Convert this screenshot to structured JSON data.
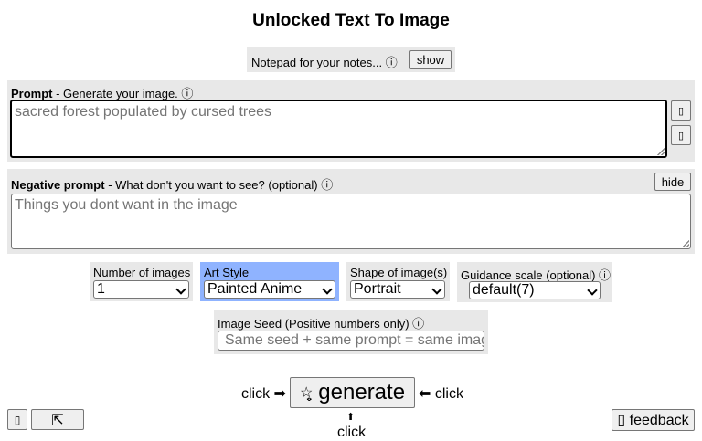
{
  "header": {
    "title": "Unlocked Text To Image"
  },
  "notepad": {
    "label": "Notepad for your notes...",
    "info_glyph": "ⓘ",
    "show_label": "show"
  },
  "prompt": {
    "label_bold": "Prompt",
    "label_rest": " - Generate your image.",
    "info_glyph": "ⓘ",
    "placeholder": "sacred forest populated by cursed trees",
    "side_buttons": [
      "▯",
      "▯"
    ]
  },
  "negative_prompt": {
    "label_bold": "Negative prompt",
    "label_rest": " - What don't you want to see? (optional)",
    "info_glyph": "ⓘ",
    "hide_label": "hide",
    "placeholder": "Things you dont want in the image"
  },
  "options": {
    "num_images": {
      "label": "Number of images",
      "value": "1"
    },
    "art_style": {
      "label": "Art Style",
      "value": "Painted Anime",
      "highlight_color": "#8fb3ff"
    },
    "shape": {
      "label": "Shape of image(s)",
      "value": "Portrait"
    },
    "guidance": {
      "label": "Guidance scale (optional)",
      "info_glyph": "ⓘ",
      "value": "default(7)"
    }
  },
  "seed": {
    "label": "Image Seed (Positive numbers only)",
    "info_glyph": "ⓘ",
    "placeholder": "Same seed + same prompt = same image"
  },
  "generate": {
    "left_hint": "click ➡",
    "button_icon": "☆̤̥",
    "button_label": "generate",
    "right_hint": "⬅ click",
    "below_arrow": "⬆",
    "below_hint": "click"
  },
  "footer": {
    "left_btn": "▯",
    "expand_btn": "⇱",
    "feedback_label": "▯ feedback"
  }
}
